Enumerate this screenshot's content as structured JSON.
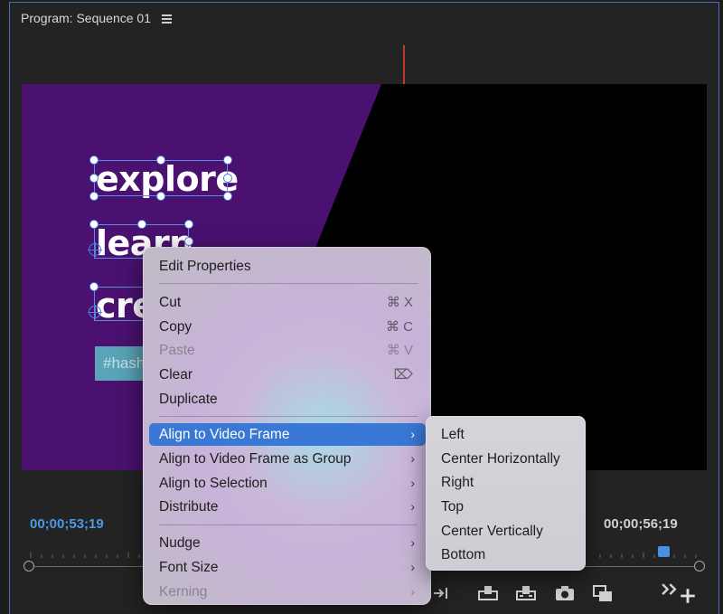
{
  "panel": {
    "title": "Program: Sequence 01"
  },
  "video": {
    "words": [
      "explore",
      "learn",
      "cre"
    ],
    "tag_text": "#hash"
  },
  "timeline": {
    "current_timecode": "00;00;53;19",
    "end_timecode": "00;00;56;19"
  },
  "context_menu": {
    "edit_properties": "Edit Properties",
    "cut": {
      "label": "Cut",
      "shortcut": "⌘ X"
    },
    "copy": {
      "label": "Copy",
      "shortcut": "⌘ C"
    },
    "paste": {
      "label": "Paste",
      "shortcut": "⌘ V"
    },
    "clear": {
      "label": "Clear",
      "shortcut": "⌦"
    },
    "duplicate": "Duplicate",
    "align_to_video_frame": "Align to Video Frame",
    "align_to_video_frame_group": "Align to Video Frame as Group",
    "align_to_selection": "Align to Selection",
    "distribute": "Distribute",
    "nudge": "Nudge",
    "font_size": "Font Size",
    "kerning": "Kerning",
    "chevron": "›"
  },
  "submenu": {
    "items": [
      "Left",
      "Center Horizontally",
      "Right",
      "Top",
      "Center Vertically",
      "Bottom"
    ]
  },
  "colors": {
    "accent": "#3a78d6",
    "timecode": "#4a9ae6",
    "purple_bg": "#4a1170"
  }
}
